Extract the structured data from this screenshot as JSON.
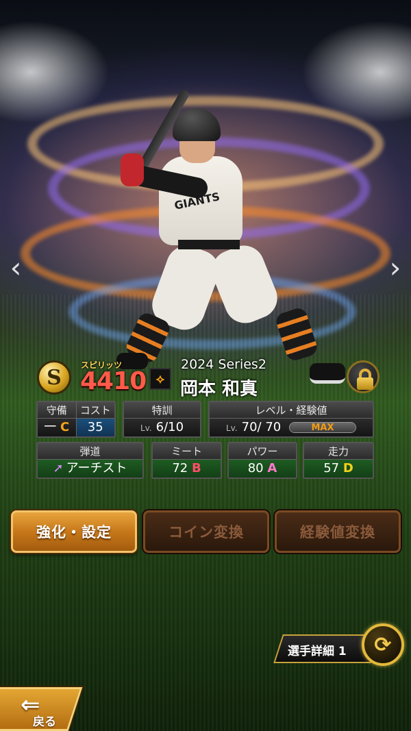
{
  "card": {
    "rank": "S",
    "spirits_label": "スピリッツ",
    "spirits_value": "4410",
    "series": "2024 Series2",
    "player_name": "岡本 和真",
    "jersey_logo": "GIANTS"
  },
  "stats": {
    "defense": {
      "label": "守備",
      "position": "一",
      "grade": "C"
    },
    "cost": {
      "label": "コスト",
      "value": "35"
    },
    "training": {
      "label": "特訓",
      "lv_prefix": "Lv.",
      "value": "6/10"
    },
    "level": {
      "label": "レベル・経験値",
      "lv_prefix": "Lv.",
      "value": "70/ 70",
      "exp_fill": 1.0,
      "exp_text": "MAX"
    },
    "trajectory": {
      "label": "弾道",
      "value": "アーチスト",
      "icon": "up-right-arrow-icon"
    },
    "meet": {
      "label": "ミート",
      "value": "72",
      "grade": "B"
    },
    "power": {
      "label": "パワー",
      "value": "80",
      "grade": "A"
    },
    "speed": {
      "label": "走力",
      "value": "57",
      "grade": "D"
    }
  },
  "actions": {
    "enhance": "強化・設定",
    "coin": "コイン変換",
    "exp": "経験値変換"
  },
  "footer": {
    "detail_label": "選手詳細 1",
    "back_label": "戻る"
  },
  "colors": {
    "accent_gold": "#e3b93a",
    "spirits_red": "#ff5a4a",
    "grade_b": "#ff4f6a",
    "grade_a": "#ff7acb",
    "grade_d": "#f2d21a",
    "grade_c": "#f2a51a",
    "max_orange": "#f39c12"
  }
}
